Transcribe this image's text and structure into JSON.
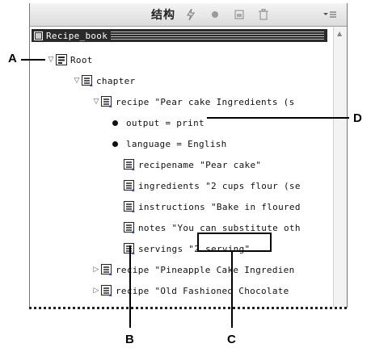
{
  "panel": {
    "title": "结构",
    "header_icons": [
      "lightning-icon",
      "dot-icon",
      "new-element-icon",
      "trash-icon",
      "panel-menu-icon"
    ]
  },
  "tree": {
    "root_label": "Recipe_book",
    "rows": [
      {
        "text": "Root"
      },
      {
        "text": "chapter"
      },
      {
        "text": "recipe \"Pear cake Ingredients (s"
      },
      {
        "text": "output = print"
      },
      {
        "text": "language = English"
      },
      {
        "text": "recipename \"Pear cake\""
      },
      {
        "text": "ingredients \"2 cups flour (se"
      },
      {
        "text": "instructions \"Bake in floured"
      },
      {
        "text": "notes \"You can substitute oth"
      },
      {
        "text": "servings \"2 serving\""
      },
      {
        "text": "recipe \"Pineapple Cake Ingredien"
      },
      {
        "text": "recipe \"Old Fashioned Chocolate"
      }
    ]
  },
  "callouts": {
    "a": "A",
    "b": "B",
    "c": "C",
    "d": "D"
  }
}
